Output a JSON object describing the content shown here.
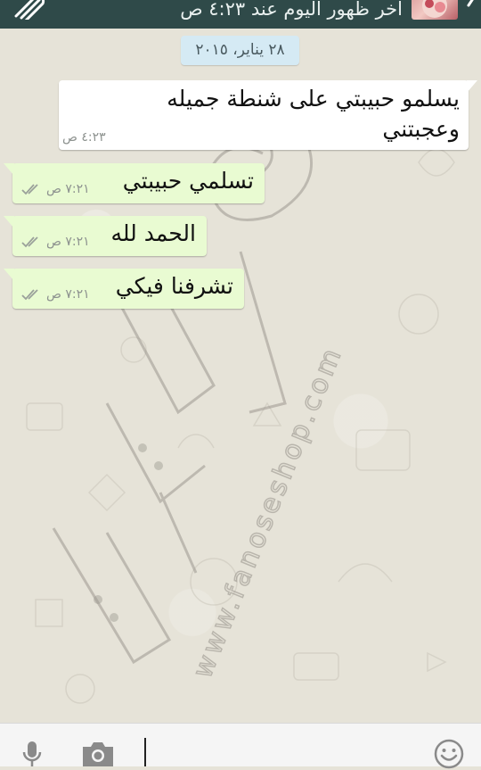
{
  "header": {
    "last_seen": "آخر ظهور اليوم عند ٤:٢٣ ص",
    "color": "#2f4a49"
  },
  "date_divider": "٢٨ يناير، ٢٠١٥",
  "messages": [
    {
      "direction": "incoming",
      "line1": "يسلمو حبيبتي على شنطة جميله",
      "line2": "وعجبتني",
      "time": "٤:٢٣ ص"
    },
    {
      "direction": "outgoing",
      "text": "تسلمي حبيبتي",
      "time": "٧:٢١ ص",
      "status": "read"
    },
    {
      "direction": "outgoing",
      "text": "الحمد لله",
      "time": "٧:٢١ ص",
      "status": "read"
    },
    {
      "direction": "outgoing",
      "text": "تشرفنا فيكي",
      "time": "٧:٢١ ص",
      "status": "read"
    }
  ],
  "watermark": {
    "text": "www.fanoseshop.com"
  },
  "icons": {
    "attach": "paperclip-icon",
    "back": "back-arrow-icon",
    "mic": "microphone-icon",
    "camera": "camera-icon",
    "emoji": "smiley-icon",
    "ticks": "double-check-icon"
  },
  "colors": {
    "incoming_bubble": "#ffffff",
    "outgoing_bubble": "#e9fbd2",
    "date_pill": "#d5eaf4",
    "wallpaper": "#e6e3d8"
  }
}
